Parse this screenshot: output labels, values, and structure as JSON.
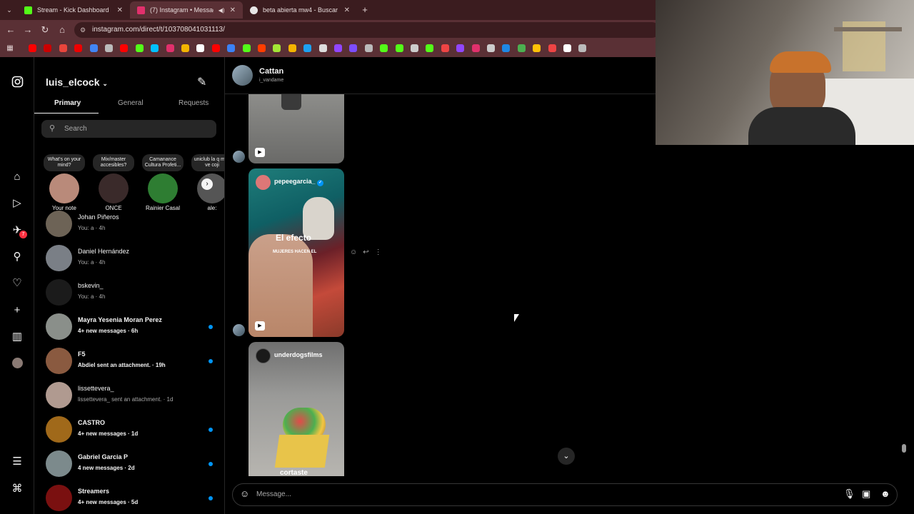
{
  "browser": {
    "tabs": [
      {
        "title": "Stream - Kick Dashboard",
        "color": "#53fc18"
      },
      {
        "title": "(7) Instagram • Messages",
        "color": "#e1306c"
      },
      {
        "title": "beta abierta mw4 - Buscar con",
        "color": "#e6e6e6"
      }
    ],
    "url": "instagram.com/direct/t/103708041031113/",
    "bookmark_colors": [
      "#ff0000",
      "#c00",
      "#e8453c",
      "#e00",
      "#4285f4",
      "#bbb",
      "#ff0000",
      "#53fc18",
      "#00c1ff",
      "#e1306c",
      "#f4b400",
      "#fff",
      "#ff0000",
      "#3b82f6",
      "#53fc18",
      "#ff3d00",
      "#a3e635",
      "#f4b400",
      "#1da1f2",
      "#ddd",
      "#9146ff",
      "#7c4dff",
      "#bbb",
      "#53fc18",
      "#53fc18",
      "#ccc",
      "#53fc18",
      "#ef4444",
      "#9146ff",
      "#e1306c",
      "#ccc",
      "#1e88e5",
      "#4caf50",
      "#ffc107",
      "#ef4444",
      "#fff",
      "#bbb"
    ]
  },
  "rail": {
    "icons": [
      "instagram-icon",
      "home-icon",
      "reels-icon",
      "messages-icon",
      "search-icon",
      "heart-icon",
      "create-icon",
      "dashboard-icon",
      "profile-avatar",
      "menu-icon",
      "threads-icon"
    ],
    "badge": "7"
  },
  "inbox": {
    "username": "luis_elcock",
    "tabs": [
      "Primary",
      "General",
      "Requests"
    ],
    "search_placeholder": "Search",
    "notes": [
      {
        "bubble": "What's on your mind?",
        "label": "Your note",
        "color": "#b98a7a"
      },
      {
        "bubble": "Mix/master accesibles?",
        "label": "ONCE",
        "color": "#3a2a2a"
      },
      {
        "bubble": "Camanance Cultura Profeti...",
        "label": "Rainier Casal",
        "color": "#2e7d32"
      },
      {
        "bubble": "uniclub la q mas ve coji",
        "label": "ale:",
        "color": "#555"
      }
    ],
    "conversations": [
      {
        "name": "Johan Piñeros",
        "preview": "You: a · 4h",
        "unread": false,
        "color": "#6d6356"
      },
      {
        "name": "Daniel Hernández",
        "preview": "You: a · 4h",
        "unread": false,
        "color": "#7a7f86"
      },
      {
        "name": "bskevin_",
        "preview": "You: a · 4h",
        "unread": false,
        "color": "#1b1b1b"
      },
      {
        "name": "Mayra Yesenia Moran Perez",
        "preview": "4+ new messages · 6h",
        "unread": true,
        "color": "#8a8f8a"
      },
      {
        "name": "F5",
        "preview": "Abdiel sent an attachment. · 19h",
        "unread": true,
        "color": "#8a5a40"
      },
      {
        "name": "lissettevera_",
        "preview": "lissettevera_ sent an attachment. · 1d",
        "unread": false,
        "color": "#b09a90"
      },
      {
        "name": "CASTRO",
        "preview": "4+ new messages · 1d",
        "unread": true,
        "color": "#a0691a"
      },
      {
        "name": "Gabriel Garcia P",
        "preview": "4 new messages · 2d",
        "unread": true,
        "color": "#7c8a8c"
      },
      {
        "name": "Streamers",
        "preview": "4+ new messages · 5d",
        "unread": true,
        "color": "#7a1010"
      }
    ]
  },
  "chat": {
    "name": "Cattan",
    "subtitle": "i_vandame",
    "reels": [
      {
        "owner": "",
        "caption": ""
      },
      {
        "owner": "pepeegarcia_",
        "caption": "El efecto",
        "caption2": "MUJERES HACEN EL"
      },
      {
        "owner": "underdogsfilms",
        "caption": "cortaste"
      }
    ],
    "composer_placeholder": "Message..."
  }
}
